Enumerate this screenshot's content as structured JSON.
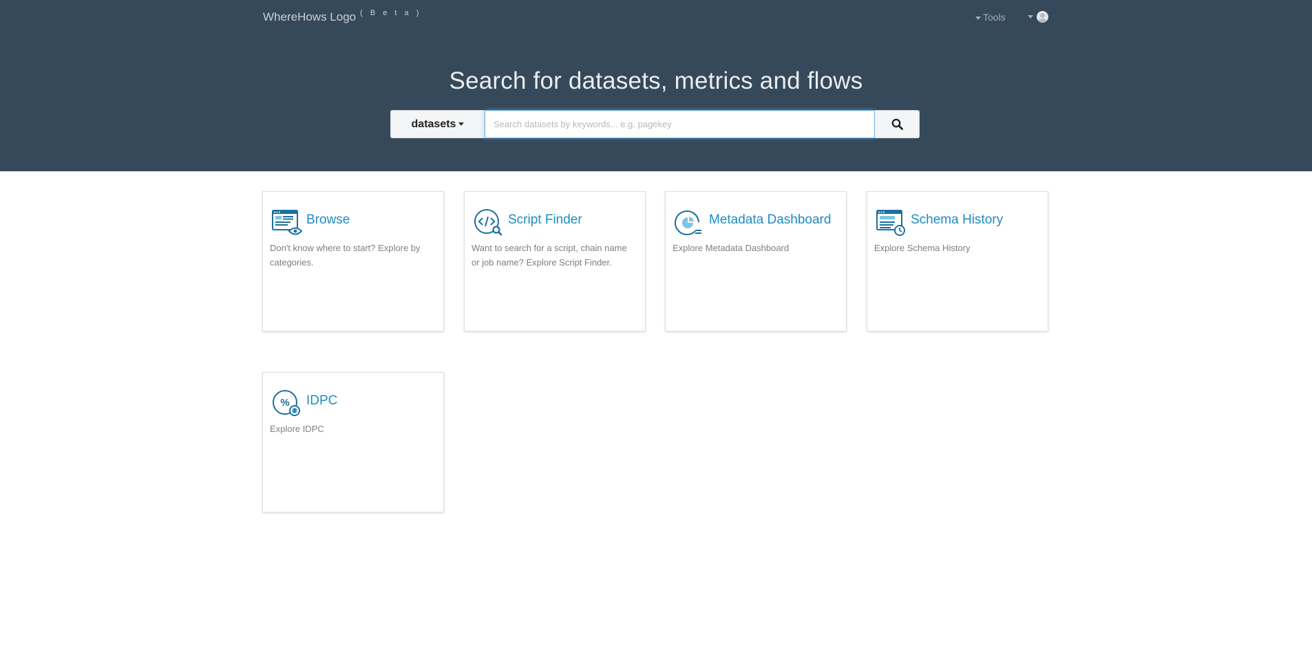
{
  "header": {
    "brand": "WhereHows Logo",
    "beta": "( B e t a )",
    "tools_label": "Tools"
  },
  "hero": {
    "title": "Search for datasets, metrics and flows"
  },
  "search": {
    "category": "datasets",
    "placeholder": "Search datasets by keywords... e.g. pagekey",
    "value": ""
  },
  "cards": [
    {
      "title": "Browse",
      "description": "Don't know where to start? Explore by categories.",
      "icon": "browse-icon"
    },
    {
      "title": "Script Finder",
      "description": "Want to search for a script, chain name or job name? Explore Script Finder.",
      "icon": "script-finder-icon"
    },
    {
      "title": "Metadata Dashboard",
      "description": "Explore Metadata Dashboard",
      "icon": "metadata-dashboard-icon"
    },
    {
      "title": "Schema History",
      "description": "Explore Schema History",
      "icon": "schema-history-icon"
    },
    {
      "title": "IDPC",
      "description": "Explore IDPC",
      "icon": "idpc-icon"
    }
  ],
  "colors": {
    "header_bg": "#36495a",
    "link": "#1d8bc4",
    "icon": "#1c6f9e",
    "icon_light": "#7fc4e4"
  }
}
